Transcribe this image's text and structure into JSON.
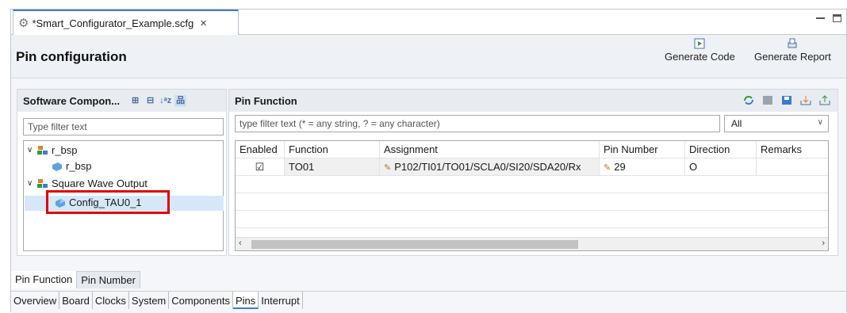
{
  "editor_tab": {
    "title": "*Smart_Configurator_Example.scfg",
    "close": "×"
  },
  "header": {
    "title": "Pin configuration",
    "generate_code": "Generate Code",
    "generate_report": "Generate Report"
  },
  "software_components": {
    "title": "Software Compon...",
    "filter_placeholder": "Type filter text",
    "tree": [
      {
        "label": "r_bsp",
        "level": 0,
        "expanded": true
      },
      {
        "label": "r_bsp",
        "level": 1
      },
      {
        "label": "Square Wave Output",
        "level": 0,
        "expanded": true
      },
      {
        "label": "Config_TAU0_1",
        "level": 1,
        "selected": true
      }
    ]
  },
  "pin_function": {
    "title": "Pin Function",
    "filter_placeholder": "type filter text (* = any string, ? = any character)",
    "filter_mode": "All",
    "columns": [
      "Enabled",
      "Function",
      "Assignment",
      "Pin Number",
      "Direction",
      "Remarks"
    ],
    "rows": [
      {
        "enabled": "☑",
        "function": "TO01",
        "assignment": "P102/TI01/TO01/SCLA0/SI20/SDA20/Rx",
        "pin_number": "29",
        "direction": "O",
        "remarks": ""
      }
    ]
  },
  "bottom_tabs": [
    "Pin Function",
    "Pin Number"
  ],
  "page_tabs": [
    "Overview",
    "Board",
    "Clocks",
    "System",
    "Components",
    "Pins",
    "Interrupt"
  ],
  "active_page_tab": "Pins"
}
